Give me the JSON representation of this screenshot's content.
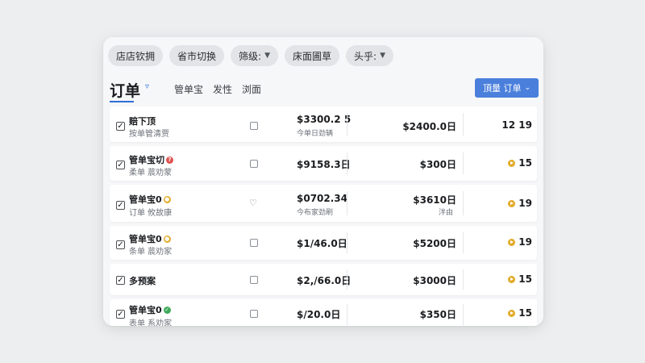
{
  "filters": [
    {
      "label": "店店钦拥",
      "has_chevron": false
    },
    {
      "label": "省市切换",
      "has_chevron": false
    },
    {
      "label": "筛级:",
      "has_chevron": true
    },
    {
      "label": "床面圃草",
      "has_chevron": false
    },
    {
      "label": "头乎:",
      "has_chevron": true
    }
  ],
  "header": {
    "title": "订单",
    "tabs": [
      "管单宝",
      "发性",
      "浏面"
    ],
    "primary_button": {
      "label": "頂量 订单"
    }
  },
  "rows": [
    {
      "checked": true,
      "name": "赔下顶",
      "badge": "",
      "sub": "按单管清贾",
      "mini": "checkbox",
      "amount1": "$3300.2 5",
      "amount1_sub": "今单日劲辆",
      "amount2": "$2400.0日",
      "amount2_sub": "",
      "count": "12 19",
      "coin": false
    },
    {
      "checked": true,
      "name": "管单宝切",
      "badge": "red",
      "sub": "柔单 莀劝蒙",
      "mini": "checkbox",
      "amount1": "$9158.3日",
      "amount1_sub": "",
      "amount2": "$300日",
      "amount2_sub": "",
      "count": "15",
      "coin": true
    },
    {
      "checked": true,
      "name": "管单宝0",
      "badge": "yellow",
      "sub": "订单 攸故康",
      "mini": "heart",
      "amount1": "$0702.34",
      "amount1_sub": "今布家劲刷",
      "amount2": "$3610日",
      "amount2_sub": "泮由",
      "count": "19",
      "coin": true
    },
    {
      "checked": true,
      "name": "管单宝0",
      "badge": "yellow",
      "sub": "条单 莀劝家",
      "mini": "checkbox",
      "amount1": "$1/46.0日",
      "amount1_sub": "",
      "amount2": "$5200日",
      "amount2_sub": "",
      "count": "19",
      "coin": true
    },
    {
      "checked": true,
      "name": "多预案",
      "badge": "",
      "sub": "",
      "mini": "checkbox",
      "amount1": "$2,/66.0日",
      "amount1_sub": "",
      "amount2": "$3000日",
      "amount2_sub": "",
      "count": "15",
      "coin": true
    },
    {
      "checked": true,
      "name": "管单宝0",
      "badge": "green",
      "sub": "表单 系劝家",
      "mini": "checkbox",
      "amount1": "$/20.0日",
      "amount1_sub": "",
      "amount2": "$350日",
      "amount2_sub": "",
      "count": "15",
      "coin": true
    }
  ],
  "colors": {
    "accent": "#4a7fdc",
    "badge_red": "#e0524f",
    "badge_yellow": "#e2ab2a",
    "badge_green": "#3faa5a"
  }
}
